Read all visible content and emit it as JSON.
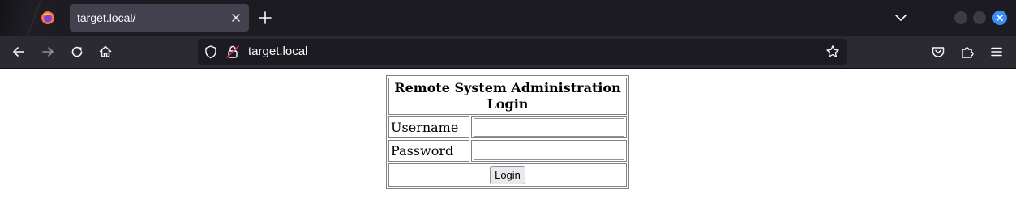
{
  "browser": {
    "tab": {
      "title": "target.local/"
    },
    "urlbar": {
      "url": "target.local"
    }
  },
  "login_form": {
    "heading": "Remote System Administration Login",
    "username_label": "Username",
    "username_value": "",
    "password_label": "Password",
    "password_value": "",
    "submit_label": "Login"
  }
}
